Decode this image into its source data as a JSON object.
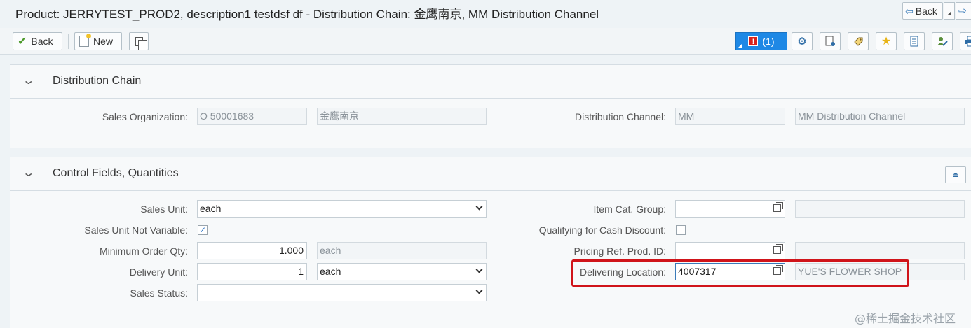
{
  "window": {
    "title": "Product: JERRYTEST_PROD2, description1 testdsf df - Distribution Chain: 金鹰南京, MM Distribution Channel",
    "nav_back_label": "Back"
  },
  "toolbar": {
    "back_label": "Back",
    "new_label": "New",
    "messages_label": "(1)",
    "messages_error_glyph": "!"
  },
  "distribution_chain": {
    "title": "Distribution Chain",
    "sales_org_label": "Sales Organization:",
    "sales_org_value": "O 50001683",
    "sales_org_desc": "金鹰南京",
    "dist_channel_label": "Distribution Channel:",
    "dist_channel_value": "MM",
    "dist_channel_desc": "MM Distribution Channel"
  },
  "control_fields": {
    "title": "Control Fields, Quantities",
    "sales_unit_label": "Sales Unit:",
    "sales_unit_value": "each",
    "sales_unit_not_variable_label": "Sales Unit Not Variable:",
    "sales_unit_not_variable_checked": true,
    "min_order_qty_label": "Minimum Order Qty:",
    "min_order_qty_value": "1.000",
    "min_order_qty_unit": "each",
    "delivery_unit_label": "Delivery Unit:",
    "delivery_unit_value": "1",
    "delivery_unit_unit": "each",
    "sales_status_label": "Sales Status:",
    "sales_status_value": "",
    "item_cat_group_label": "Item Cat. Group:",
    "item_cat_group_value": "",
    "qualifying_cash_discount_label": "Qualifying for Cash Discount:",
    "qualifying_cash_discount_checked": false,
    "pricing_ref_label": "Pricing Ref. Prod. ID:",
    "pricing_ref_value": "",
    "delivering_location_label": "Delivering Location:",
    "delivering_location_value": "4007317",
    "delivering_location_desc": "YUE'S FLOWER SHOP"
  },
  "watermark": "@稀土掘金技术社区",
  "colors": {
    "highlight": "#d0141a",
    "message_button": "#1e88e5",
    "background": "#eef3f6"
  }
}
